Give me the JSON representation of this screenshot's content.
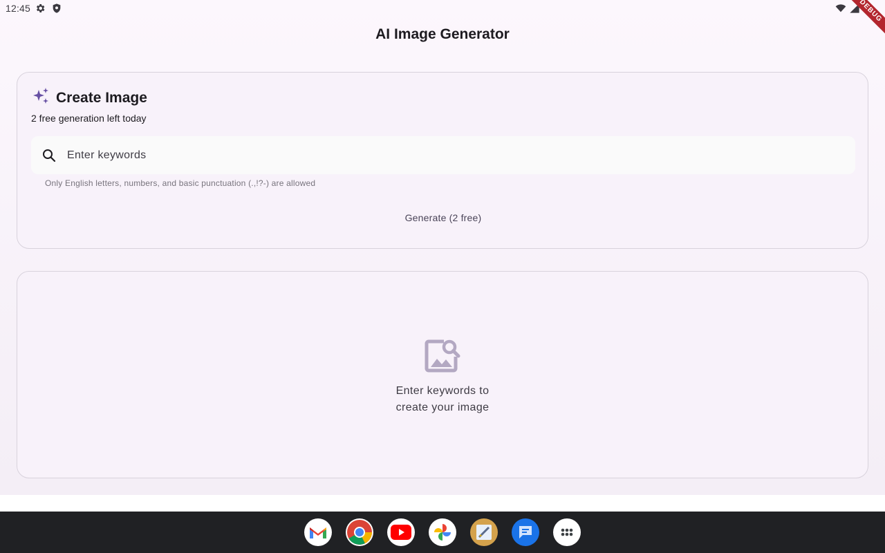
{
  "status_bar": {
    "time": "12:45",
    "debug_label": "DEBUG"
  },
  "app": {
    "title": "AI Image Generator",
    "create": {
      "title": "Create Image",
      "free_left": "2 free generation left today",
      "search_placeholder": "Enter keywords",
      "search_value": "",
      "helper": "Only English letters, numbers, and basic punctuation (.,!?-) are allowed",
      "generate_label": "Generate (2 free)"
    },
    "result": {
      "empty_text": "Enter keywords to create your image"
    }
  },
  "taskbar": {
    "apps": [
      "gmail-icon",
      "chrome-icon",
      "youtube-icon",
      "photos-icon",
      "sketch-app-icon",
      "messages-icon",
      "app-launcher-icon"
    ]
  },
  "colors": {
    "accent": "#6750a4",
    "card_bg": "#f8f2fa",
    "card_border": "#d8d2dc",
    "taskbar_bg": "#202124"
  }
}
